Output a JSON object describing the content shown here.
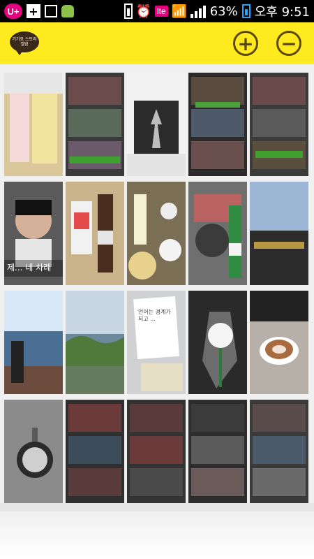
{
  "status_bar": {
    "carrier_badge": "U+",
    "lte_label": "lte",
    "battery_percent": "63%",
    "time": "오후 9:51"
  },
  "app_bar": {
    "logo_text": "기기요 스토리 앨범",
    "add_label": "+",
    "remove_label": "−"
  },
  "grid": {
    "tiles": [
      {
        "id": "t1",
        "desc": "books",
        "bg": "#d9c79a"
      },
      {
        "id": "t2",
        "desc": "tv-collage",
        "bg": "#3a3a3a"
      },
      {
        "id": "t3",
        "desc": "frame",
        "bg": "#f2f2f2"
      },
      {
        "id": "t4",
        "desc": "tv-collage",
        "bg": "#2b2b2b"
      },
      {
        "id": "t5",
        "desc": "tv-collage",
        "bg": "#3b3b3b"
      },
      {
        "id": "t6",
        "desc": "man",
        "bg": "#5b5b5b"
      },
      {
        "id": "t7",
        "desc": "drinks",
        "bg": "#c9b38b"
      },
      {
        "id": "t8",
        "desc": "table-food",
        "bg": "#7a6e55"
      },
      {
        "id": "t9",
        "desc": "grill",
        "bg": "#6f6f6f"
      },
      {
        "id": "t10",
        "desc": "street",
        "bg": "#4f5b6a"
      },
      {
        "id": "t11",
        "desc": "sea",
        "bg": "#7fa6c3"
      },
      {
        "id": "t12",
        "desc": "coast",
        "bg": "#6c8a9c"
      },
      {
        "id": "t13",
        "desc": "note",
        "bg": "#cfd1d2"
      },
      {
        "id": "t14",
        "desc": "rose",
        "bg": "#2a2a2a"
      },
      {
        "id": "t15",
        "desc": "coffee",
        "bg": "#b7b0a8"
      },
      {
        "id": "t16",
        "desc": "watch",
        "bg": "#8b8b8b"
      },
      {
        "id": "t17",
        "desc": "tv-collage",
        "bg": "#2f2f2f"
      },
      {
        "id": "t18",
        "desc": "tv-collage",
        "bg": "#333333"
      },
      {
        "id": "t19",
        "desc": "tv-collage",
        "bg": "#2d2d2d"
      },
      {
        "id": "t20",
        "desc": "tv-collage",
        "bg": "#3a3a3a"
      }
    ],
    "tile_text": {
      "t6_caption": "제... 네 차례",
      "t13_note": "언어는 경계가 되고 ..."
    }
  },
  "colors": {
    "app_bar_bg": "#ffea1f",
    "status_bar_bg": "#000000",
    "accent_brand": "#e5007d"
  }
}
